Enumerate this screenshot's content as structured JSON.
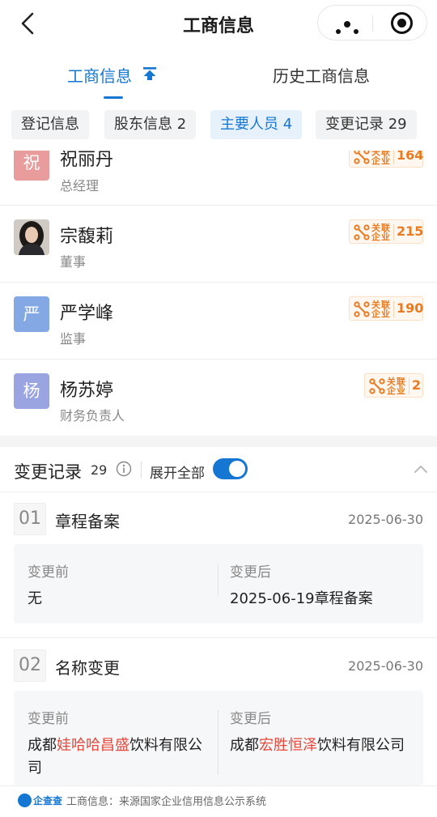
{
  "nav": {
    "title": "工商信息",
    "back_icon": "chevron-left-icon",
    "more_icon": "more-dots-icon",
    "close_icon": "target-circle-icon"
  },
  "main_tabs": [
    {
      "label": "工商信息",
      "active": true
    },
    {
      "label": "历史工商信息",
      "active": false
    }
  ],
  "chips": [
    {
      "label": "登记信息"
    },
    {
      "label": "股东信息 2"
    },
    {
      "label": "主要人员 4"
    },
    {
      "label": "变更记录 29"
    }
  ],
  "persons": [
    {
      "avatar_text": "祝",
      "avatar_color": "#e89c9b",
      "name": "祝丽丹",
      "role": "总经理",
      "rel_label_1": "关联",
      "rel_label_2": "企业",
      "rel_count": "164"
    },
    {
      "avatar_text": "",
      "avatar_color": "#3b3b3b",
      "name": "宗馥莉",
      "role": "董事",
      "rel_label_1": "关联",
      "rel_label_2": "企业",
      "rel_count": "215"
    },
    {
      "avatar_text": "严",
      "avatar_color": "#83a8e4",
      "name": "严学峰",
      "role": "监事",
      "rel_label_1": "关联",
      "rel_label_2": "企业",
      "rel_count": "190"
    },
    {
      "avatar_text": "杨",
      "avatar_color": "#9aa4e0",
      "name": "杨苏婷",
      "role": "财务负责人",
      "rel_label_1": "关联",
      "rel_label_2": "企业",
      "rel_count": "2"
    }
  ],
  "changes": {
    "title": "变更记录",
    "count": "29",
    "expand_label": "展开全部",
    "expand_on": true,
    "records": [
      {
        "num": "01",
        "title": "章程备案",
        "date": "2025-06-30",
        "before_label": "变更前",
        "after_label": "变更后",
        "before": "无",
        "after": "2025-06-19章程备案"
      },
      {
        "num": "02",
        "title": "名称变更",
        "date": "2025-06-30",
        "before_label": "变更前",
        "after_label": "变更后",
        "before_prefix": "成都",
        "before_hl": "娃哈哈昌盛",
        "before_suffix": "饮料有限公司",
        "after_prefix": "成都",
        "after_hl": "宏胜恒泽",
        "after_suffix": "饮料有限公司"
      }
    ]
  },
  "footer": {
    "logo_text": "企查查",
    "source": "工商信息：来源国家企业信用信息公示系统"
  },
  "colors": {
    "accent": "#1677d2",
    "highlight": "#e8483b",
    "relation": "#e97b22"
  }
}
